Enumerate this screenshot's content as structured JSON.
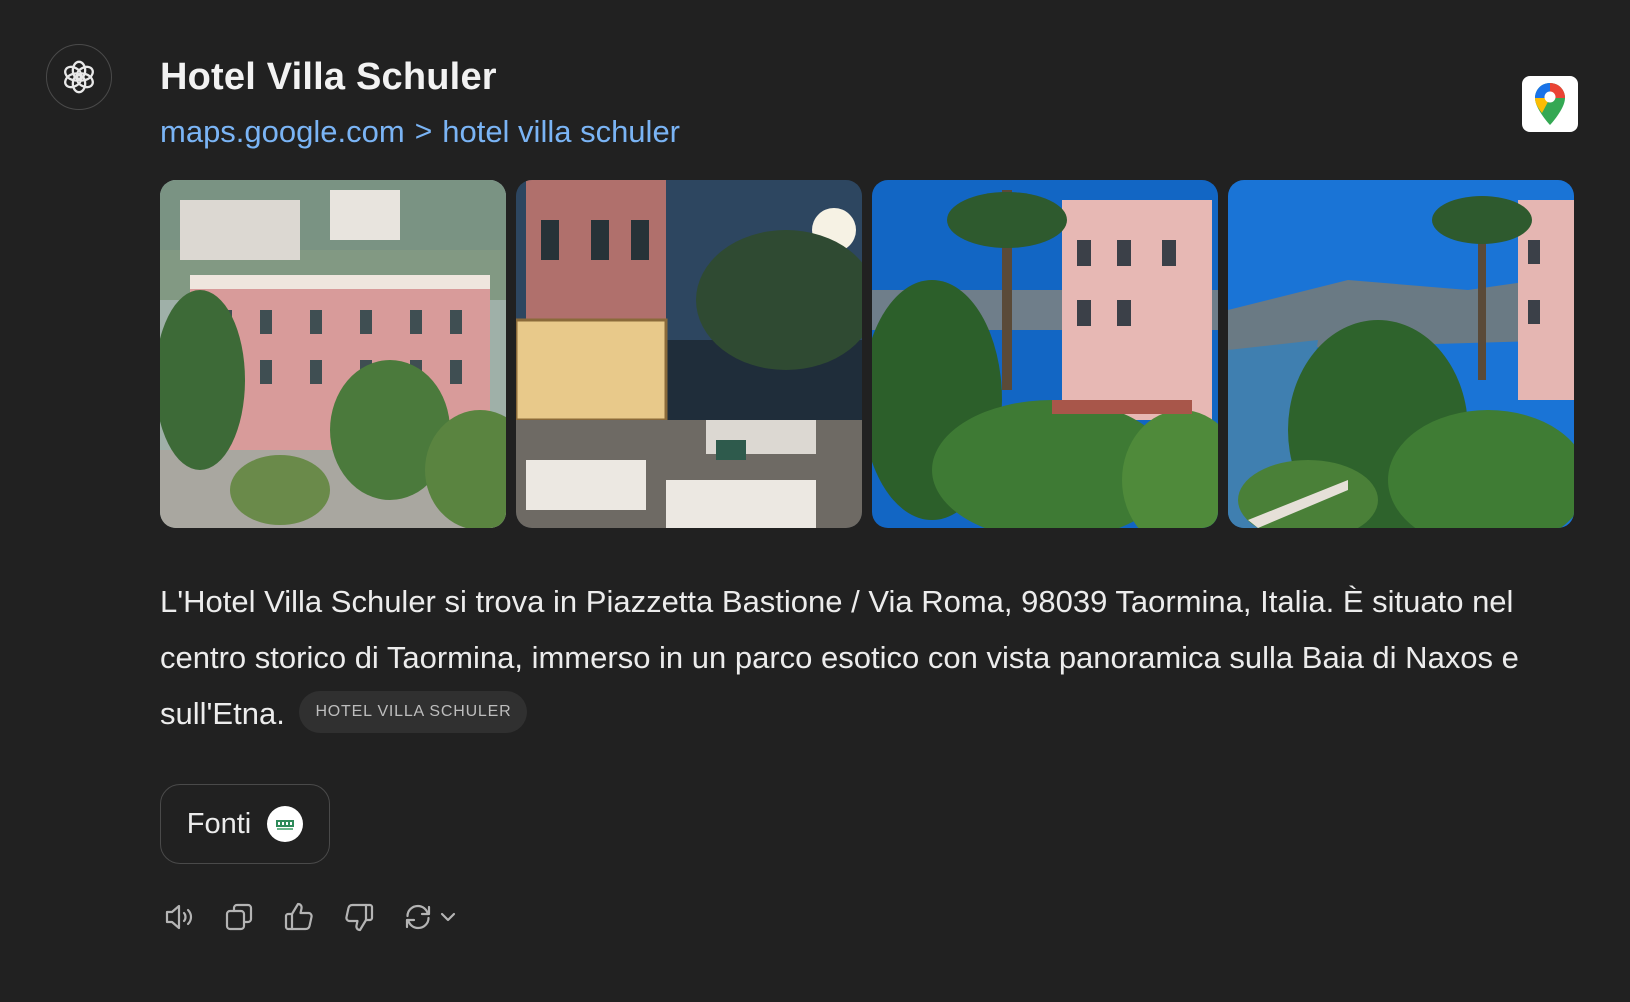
{
  "assistant": {
    "avatar_icon": "openai-logo-icon"
  },
  "result": {
    "title": "Hotel Villa Schuler",
    "source_domain": "maps.google.com",
    "breadcrumb_separator": ">",
    "source_path": "hotel villa schuler",
    "badge_icon": "google-maps-pin-icon"
  },
  "photos": [
    {
      "name": "hotel-facade-photo"
    },
    {
      "name": "hotel-terrace-night-photo"
    },
    {
      "name": "hotel-palms-sea-view-photo"
    },
    {
      "name": "hotel-bay-view-photo"
    }
  ],
  "description": {
    "text": "L'Hotel Villa Schuler si trova in Piazzetta Bastione / Via Roma, 98039 Taormina, Italia. È situato nel centro storico di Taormina, immerso in un parco esotico con vista panoramica sulla Baia di Naxos e sull'Etna.",
    "citation_chip": "HOTEL VILLA SCHULER"
  },
  "sources": {
    "label": "Fonti"
  },
  "actions": [
    {
      "name": "read-aloud",
      "icon": "speaker-icon"
    },
    {
      "name": "copy",
      "icon": "copy-icon"
    },
    {
      "name": "good-response",
      "icon": "thumbs-up-icon"
    },
    {
      "name": "bad-response",
      "icon": "thumbs-down-icon"
    },
    {
      "name": "regenerate",
      "icon": "refresh-icon"
    }
  ],
  "colors": {
    "background": "#212121",
    "link": "#7ab4f5",
    "text": "#ececec"
  }
}
